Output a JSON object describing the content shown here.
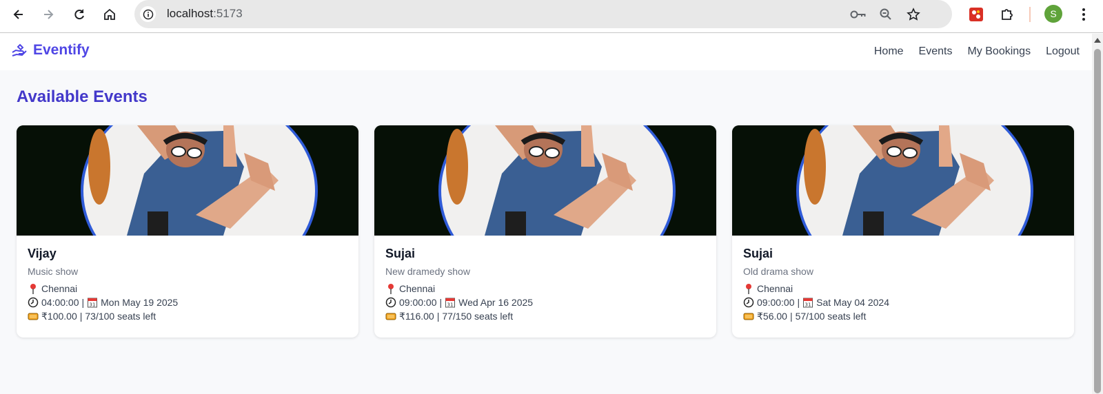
{
  "browser": {
    "url_host": "localhost",
    "url_port": ":5173",
    "avatar_letter": "S"
  },
  "app": {
    "brand": "Eventify",
    "nav": [
      "Home",
      "Events",
      "My Bookings",
      "Logout"
    ],
    "page_title": "Available Events"
  },
  "events": [
    {
      "title": "Vijay",
      "description": "Music show",
      "location": "Chennai",
      "time": "04:00:00",
      "date": "Mon May 19 2025",
      "price": "₹100.00",
      "seats": "73/100 seats left"
    },
    {
      "title": "Sujai",
      "description": "New dramedy show",
      "location": "Chennai",
      "time": "09:00:00",
      "date": "Wed Apr 16 2025",
      "price": "₹116.00",
      "seats": "77/150 seats left"
    },
    {
      "title": "Sujai",
      "description": "Old drama show",
      "location": "Chennai",
      "time": "09:00:00",
      "date": "Sat May 04 2024",
      "price": "₹56.00",
      "seats": "57/100 seats left"
    }
  ],
  "icons": {
    "location": "pin-icon",
    "time": "clock-icon",
    "date": "calendar-icon",
    "price": "ticket-icon"
  },
  "colors": {
    "brand": "#4f46e5",
    "title": "#4338ca",
    "avatar": "#5fa33a"
  }
}
